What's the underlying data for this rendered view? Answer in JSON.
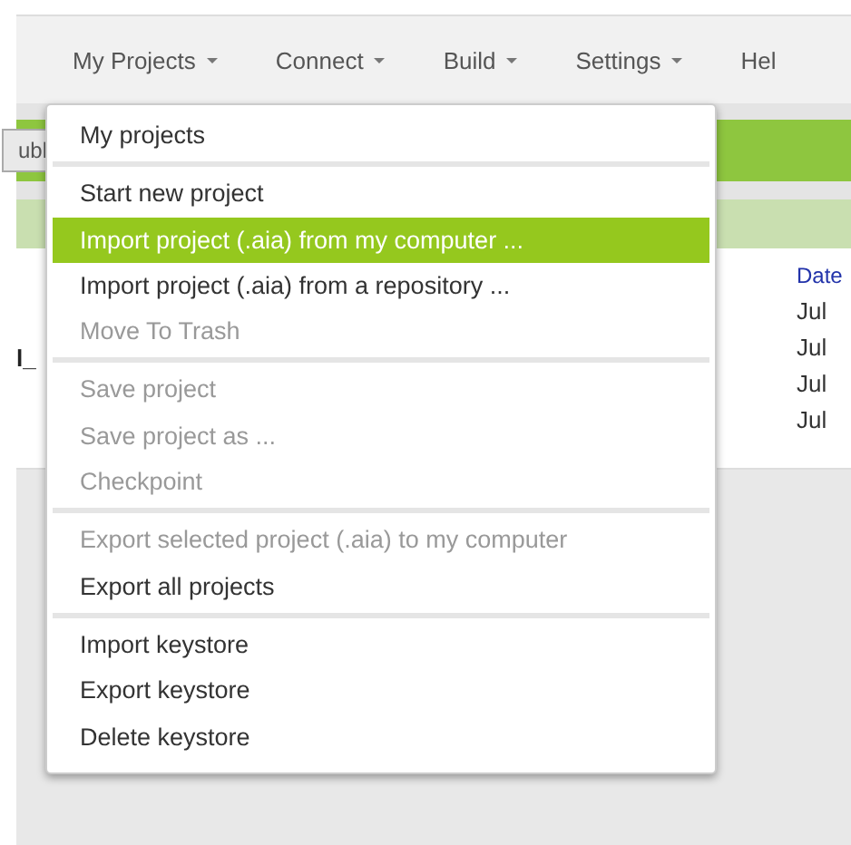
{
  "nav": [
    {
      "label": "My Projects",
      "caret": true
    },
    {
      "label": "Connect",
      "caret": true
    },
    {
      "label": "Build",
      "caret": true
    },
    {
      "label": "Settings",
      "caret": true
    },
    {
      "label": "Hel",
      "caret": false
    }
  ],
  "toolbar": {
    "button": "ubl"
  },
  "table": {
    "header": "Date",
    "name_fragment": "l_",
    "dates": [
      "Jul",
      "Jul",
      "Jul",
      "Jul"
    ]
  },
  "menu": {
    "sections": [
      [
        {
          "label": "My projects",
          "disabled": false,
          "selected": false
        }
      ],
      [
        {
          "label": "Start new project",
          "disabled": false,
          "selected": false
        },
        {
          "label": "Import project (.aia) from my computer ...",
          "disabled": false,
          "selected": true
        },
        {
          "label": "Import project (.aia) from a repository ...",
          "disabled": false,
          "selected": false
        },
        {
          "label": "Move To Trash",
          "disabled": true,
          "selected": false
        }
      ],
      [
        {
          "label": "Save project",
          "disabled": true,
          "selected": false
        },
        {
          "label": "Save project as ...",
          "disabled": true,
          "selected": false
        },
        {
          "label": "Checkpoint",
          "disabled": true,
          "selected": false
        }
      ],
      [
        {
          "label": "Export selected project (.aia) to my computer",
          "disabled": true,
          "selected": false
        },
        {
          "label": "Export all projects",
          "disabled": false,
          "selected": false
        }
      ],
      [
        {
          "label": "Import keystore",
          "disabled": false,
          "selected": false
        },
        {
          "label": "Export keystore",
          "disabled": false,
          "selected": false
        },
        {
          "label": "Delete keystore",
          "disabled": false,
          "selected": false
        }
      ]
    ]
  }
}
